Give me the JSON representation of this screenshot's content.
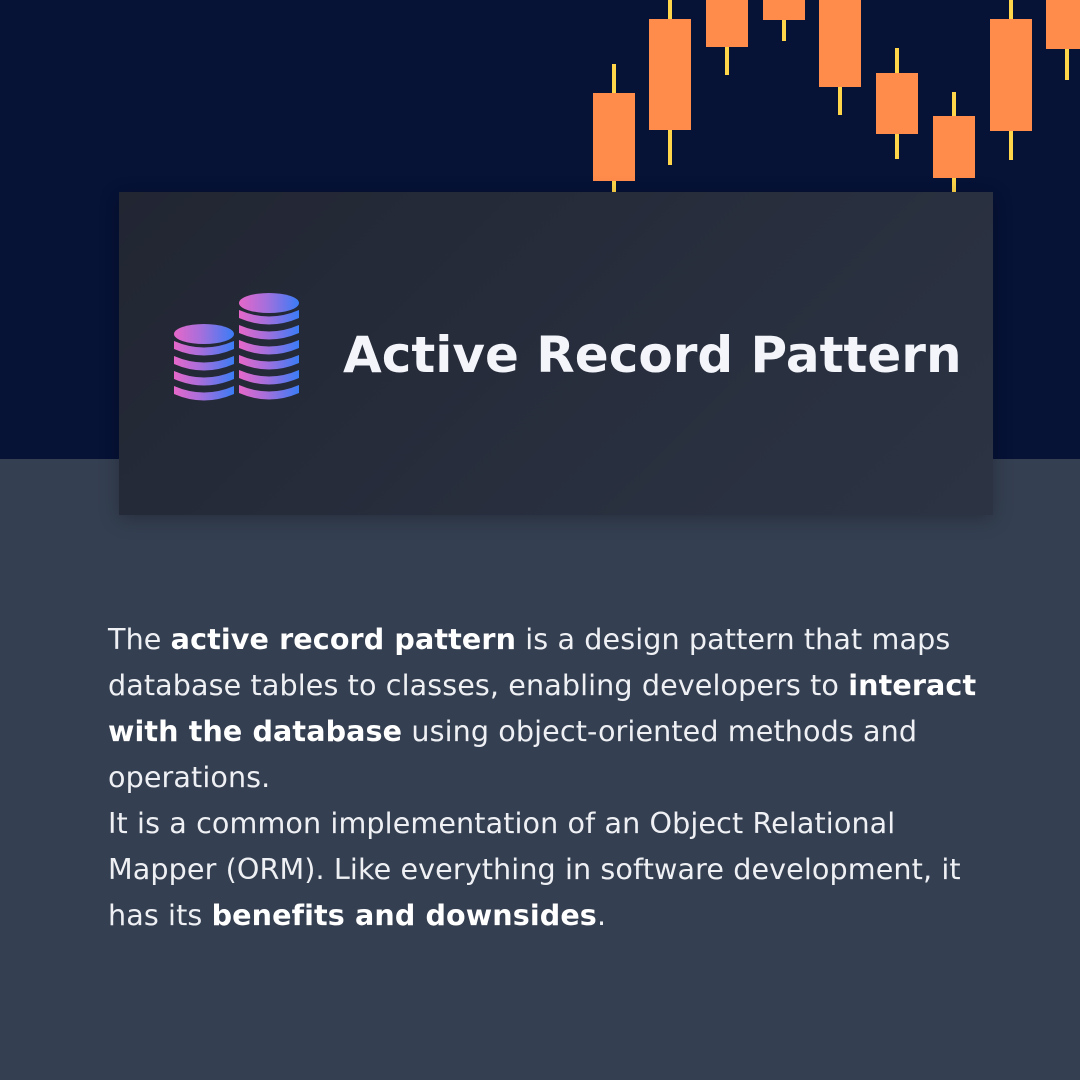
{
  "title": "Active Record Pattern",
  "colors": {
    "top_band": "#061236",
    "page_background": "#343f51",
    "candle_body": "#ff8c4b",
    "candle_wick": "#ffd54a",
    "db_icon_gradient_pink": "#e667c9",
    "db_icon_gradient_blue": "#3a7cf6"
  },
  "icons": {
    "logo": "database-stacks-icon",
    "decoration": "candlestick-chart"
  },
  "paragraph1": {
    "t1": "The ",
    "b1": "active record pattern",
    "t2": " is a design pattern that maps database tables to classes, enabling developers to ",
    "b2": "interact with the database",
    "t3": " using object-oriented methods and operations."
  },
  "paragraph2": {
    "t1": "It is a common implementation of an Object Relational Mapper (ORM). Like everything in software development, it has its ",
    "b1": "benefits and downsides",
    "t2": "."
  }
}
